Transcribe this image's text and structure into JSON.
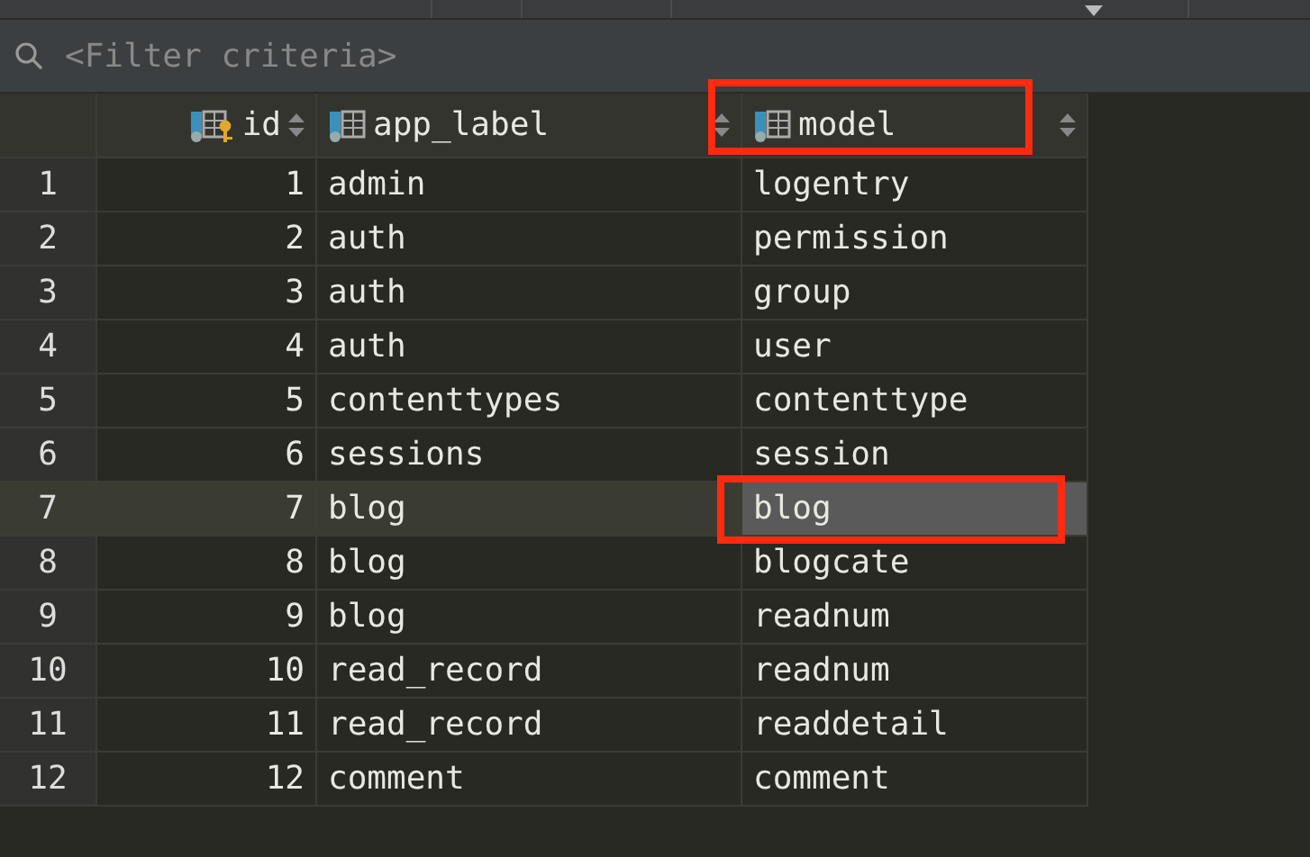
{
  "filter": {
    "placeholder": "<Filter criteria>"
  },
  "columns": [
    {
      "name": "id",
      "kind": "key",
      "annotated": false
    },
    {
      "name": "app_label",
      "kind": "plain",
      "annotated": false
    },
    {
      "name": "model",
      "kind": "plain",
      "annotated": true
    }
  ],
  "rows": [
    {
      "number": "1",
      "cells": [
        {
          "text": "1",
          "focused": false
        },
        {
          "text": "admin",
          "focused": false
        },
        {
          "text": "logentry",
          "focused": false
        }
      ],
      "selected": false
    },
    {
      "number": "2",
      "cells": [
        {
          "text": "2",
          "focused": false
        },
        {
          "text": "auth",
          "focused": false
        },
        {
          "text": "permission",
          "focused": false
        }
      ],
      "selected": false
    },
    {
      "number": "3",
      "cells": [
        {
          "text": "3",
          "focused": false
        },
        {
          "text": "auth",
          "focused": false
        },
        {
          "text": "group",
          "focused": false
        }
      ],
      "selected": false
    },
    {
      "number": "4",
      "cells": [
        {
          "text": "4",
          "focused": false
        },
        {
          "text": "auth",
          "focused": false
        },
        {
          "text": "user",
          "focused": false
        }
      ],
      "selected": false
    },
    {
      "number": "5",
      "cells": [
        {
          "text": "5",
          "focused": false
        },
        {
          "text": "contenttypes",
          "focused": false
        },
        {
          "text": "contenttype",
          "focused": false
        }
      ],
      "selected": false
    },
    {
      "number": "6",
      "cells": [
        {
          "text": "6",
          "focused": false
        },
        {
          "text": "sessions",
          "focused": false
        },
        {
          "text": "session",
          "focused": false
        }
      ],
      "selected": false
    },
    {
      "number": "7",
      "cells": [
        {
          "text": "7",
          "focused": false
        },
        {
          "text": "blog",
          "focused": false
        },
        {
          "text": "blog",
          "focused": true,
          "annotated": true
        }
      ],
      "selected": true
    },
    {
      "number": "8",
      "cells": [
        {
          "text": "8",
          "focused": false
        },
        {
          "text": "blog",
          "focused": false
        },
        {
          "text": "blogcate",
          "focused": false
        }
      ],
      "selected": false
    },
    {
      "number": "9",
      "cells": [
        {
          "text": "9",
          "focused": false
        },
        {
          "text": "blog",
          "focused": false
        },
        {
          "text": "readnum",
          "focused": false
        }
      ],
      "selected": false
    },
    {
      "number": "10",
      "cells": [
        {
          "text": "10",
          "focused": false
        },
        {
          "text": "read_record",
          "focused": false
        },
        {
          "text": "readnum",
          "focused": false
        }
      ],
      "selected": false
    },
    {
      "number": "11",
      "cells": [
        {
          "text": "11",
          "focused": false
        },
        {
          "text": "read_record",
          "focused": false
        },
        {
          "text": "readdetail",
          "focused": false
        }
      ],
      "selected": false
    },
    {
      "number": "12",
      "cells": [
        {
          "text": "12",
          "focused": false
        },
        {
          "text": "comment",
          "focused": false
        },
        {
          "text": "comment",
          "focused": false
        }
      ],
      "selected": false
    }
  ]
}
